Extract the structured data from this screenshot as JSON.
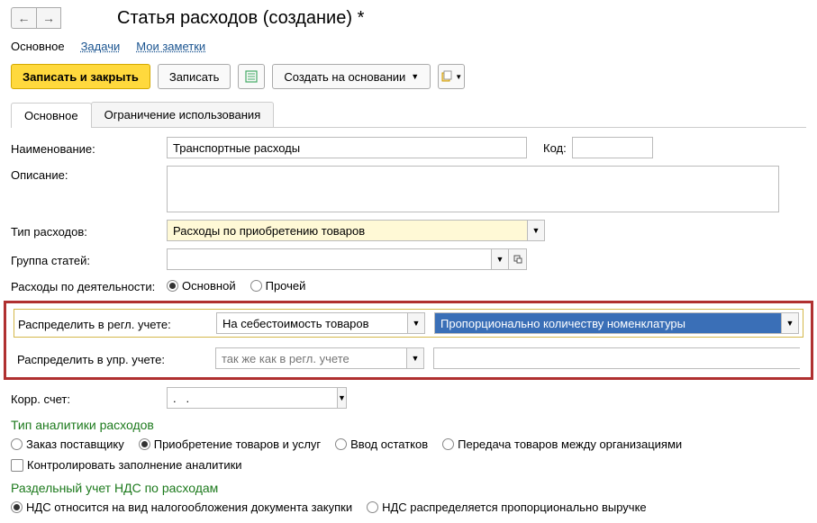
{
  "header": {
    "title": "Статья расходов (создание) *"
  },
  "link_tabs": {
    "main": "Основное",
    "tasks": "Задачи",
    "notes": "Мои заметки"
  },
  "toolbar": {
    "write_close": "Записать и закрыть",
    "write": "Записать",
    "create_based": "Создать на основании"
  },
  "tabs": {
    "main": "Основное",
    "restrict": "Ограничение использования"
  },
  "form": {
    "name_label": "Наименование:",
    "name_value": "Транспортные расходы",
    "code_label": "Код:",
    "code_value": "",
    "desc_label": "Описание:",
    "desc_value": "",
    "type_label": "Тип расходов:",
    "type_value": "Расходы по приобретению товаров",
    "group_label": "Группа статей:",
    "group_value": "",
    "activity_label": "Расходы по деятельности:",
    "activity_main": "Основной",
    "activity_other": "Прочей",
    "dist_regl_label": "Распределить в регл. учете:",
    "dist_regl_value": "На себестоимость товаров",
    "dist_rule_value": "Пропорционально количеству номенклатуры",
    "dist_mgmt_label": "Распределить в упр. учете:",
    "dist_mgmt_placeholder": "так же как в регл. учете",
    "corr_label": "Корр. счет:",
    "corr_value": ".   .",
    "analytics_title": "Тип аналитики расходов",
    "an_order": "Заказ поставщику",
    "an_purchase": "Приобретение товаров и услуг",
    "an_input": "Ввод остатков",
    "an_transfer": "Передача товаров между организациями",
    "control_check": "Контролировать заполнение аналитики",
    "vat_title": "Раздельный учет НДС по расходам",
    "vat_doc": "НДС относится на вид налогообложения документа закупки",
    "vat_prop": "НДС распределяется пропорционально выручке"
  }
}
